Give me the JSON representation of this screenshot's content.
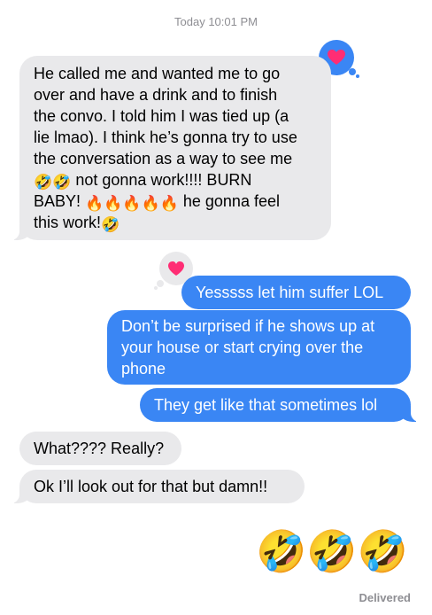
{
  "thread": {
    "timestamp": "Today 10:01 PM",
    "status": "Delivered"
  },
  "colors": {
    "outgoing": "#3a86f4",
    "incoming": "#e9e9eb",
    "tapback_bubble": "#3a86f4",
    "tapback_heart": "#ff2d74"
  },
  "messages": {
    "m1": {
      "l1": "He called me and wanted me to go",
      "l2": "over and have a drink and to finish",
      "l3": "the convo. I told him I was tied up (a",
      "l4": "lie lmao). I think he’s gonna try to use",
      "l5": "the conversation as a way to see me",
      "l6_emoji": "🤣🤣",
      "l6_text": " not gonna work!!!! BURN",
      "l7_text_a": "BABY! ",
      "l7_emoji": "🔥🔥🔥🔥🔥",
      "l7_text_b": " he gonna feel",
      "l8_text": "this work!",
      "l8_emoji": "🤣",
      "reaction": "heart-icon"
    },
    "m2": {
      "text": "Yesssss let him suffer LOL",
      "reaction": "heart-icon"
    },
    "m3": {
      "l1": "Don’t be surprised if he shows up at",
      "l2": "your house or start crying over the",
      "l3": "phone"
    },
    "m4": {
      "text": "They get like that sometimes lol"
    },
    "m5": {
      "text": "What???? Really?"
    },
    "m6": {
      "text": "Ok I’ll look out for that but damn!!"
    },
    "m7": {
      "emoji": "🤣🤣🤣"
    }
  }
}
